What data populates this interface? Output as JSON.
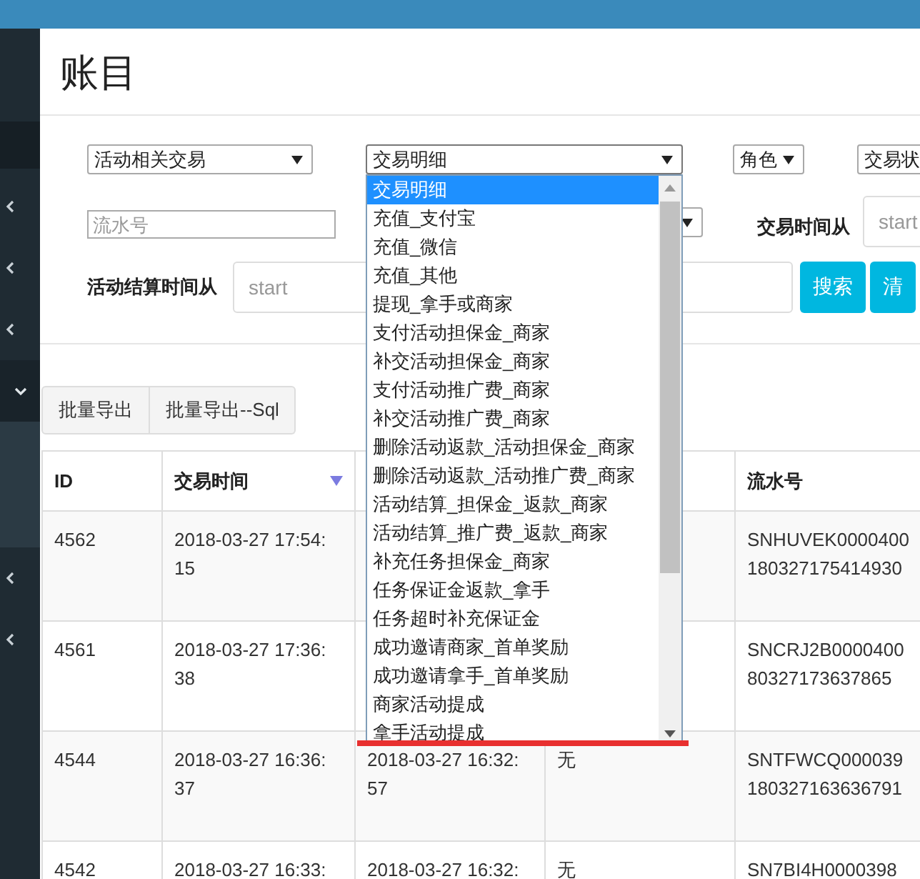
{
  "sidebar": {
    "items": [
      {
        "kind": "plain",
        "selected": true
      },
      {
        "kind": "menu",
        "expanded": false
      },
      {
        "kind": "menu",
        "expanded": false
      },
      {
        "kind": "menu",
        "expanded": false
      },
      {
        "kind": "menu",
        "expanded": true
      },
      {
        "kind": "menu",
        "expanded": false
      },
      {
        "kind": "menu",
        "expanded": false
      }
    ]
  },
  "page": {
    "title": "账目"
  },
  "filter_rows": [
    [
      {
        "kind": "select",
        "value": "活动相关交易"
      },
      {
        "kind": "select",
        "value": "交易明细",
        "open": true
      },
      {
        "kind": "select",
        "value": "角色"
      },
      {
        "kind": "select",
        "value": "交易状"
      }
    ],
    [
      {
        "kind": "input",
        "placeholder": "流水号"
      },
      {
        "kind": "select"
      },
      {
        "kind": "label",
        "text": "交易时间从"
      },
      {
        "kind": "input",
        "placeholder": "start"
      }
    ],
    [
      {
        "kind": "label",
        "text": "活动结算时间从"
      },
      {
        "kind": "input",
        "placeholder": "start"
      },
      {
        "kind": "button",
        "text": "搜索"
      },
      {
        "kind": "button",
        "text": "清"
      }
    ]
  ],
  "dropdown": {
    "options": [
      {
        "label": "交易明细",
        "selected": true
      },
      {
        "label": "充值_支付宝",
        "selected": false
      },
      {
        "label": "充值_微信",
        "selected": false
      },
      {
        "label": "充值_其他",
        "selected": false
      },
      {
        "label": "提现_拿手或商家",
        "selected": false
      },
      {
        "label": "支付活动担保金_商家",
        "selected": false
      },
      {
        "label": "补交活动担保金_商家",
        "selected": false
      },
      {
        "label": "支付活动推广费_商家",
        "selected": false
      },
      {
        "label": "补交活动推广费_商家",
        "selected": false
      },
      {
        "label": "删除活动返款_活动担保金_商家",
        "selected": false
      },
      {
        "label": "删除活动返款_活动推广费_商家",
        "selected": false
      },
      {
        "label": "活动结算_担保金_返款_商家",
        "selected": false
      },
      {
        "label": "活动结算_推广费_返款_商家",
        "selected": false
      },
      {
        "label": "补充任务担保金_商家",
        "selected": false
      },
      {
        "label": "任务保证金返款_拿手",
        "selected": false
      },
      {
        "label": "任务超时补充保证金",
        "selected": false
      },
      {
        "label": "成功邀请商家_首单奖励",
        "selected": false
      },
      {
        "label": "成功邀请拿手_首单奖励",
        "selected": false
      },
      {
        "label": "商家活动提成",
        "selected": false
      },
      {
        "label": "拿手活动提成",
        "selected": false
      }
    ]
  },
  "export_buttons": [
    "批量导出",
    "批量导出--Sql"
  ],
  "table": {
    "columns": [
      {
        "label": "ID",
        "sorted": false
      },
      {
        "label": "交易时间",
        "sorted": true
      },
      null,
      null,
      {
        "label": "流水号",
        "sorted": false
      }
    ],
    "rows": [
      [
        [
          "4562"
        ],
        [
          "2018-03-27 17:54:",
          "15"
        ],
        null,
        null,
        [
          "SNHUVEK0000400",
          "180327175414930"
        ]
      ],
      [
        [
          "4561"
        ],
        [
          "2018-03-27 17:36:",
          "38"
        ],
        null,
        null,
        [
          "SNCRJ2B0000400",
          "80327173637865"
        ]
      ],
      [
        [
          "4544"
        ],
        [
          "2018-03-27 16:36:",
          "37"
        ],
        [
          "2018-03-27 16:32:",
          "57"
        ],
        [
          "无"
        ],
        [
          "SNTFWCQ000039",
          "180327163636791"
        ]
      ],
      [
        [
          "4542"
        ],
        [
          "2018-03-27 16:33:"
        ],
        [
          "2018-03-27 16:32:"
        ],
        [
          "无"
        ],
        [
          "SN7BI4H0000398"
        ]
      ]
    ]
  }
}
